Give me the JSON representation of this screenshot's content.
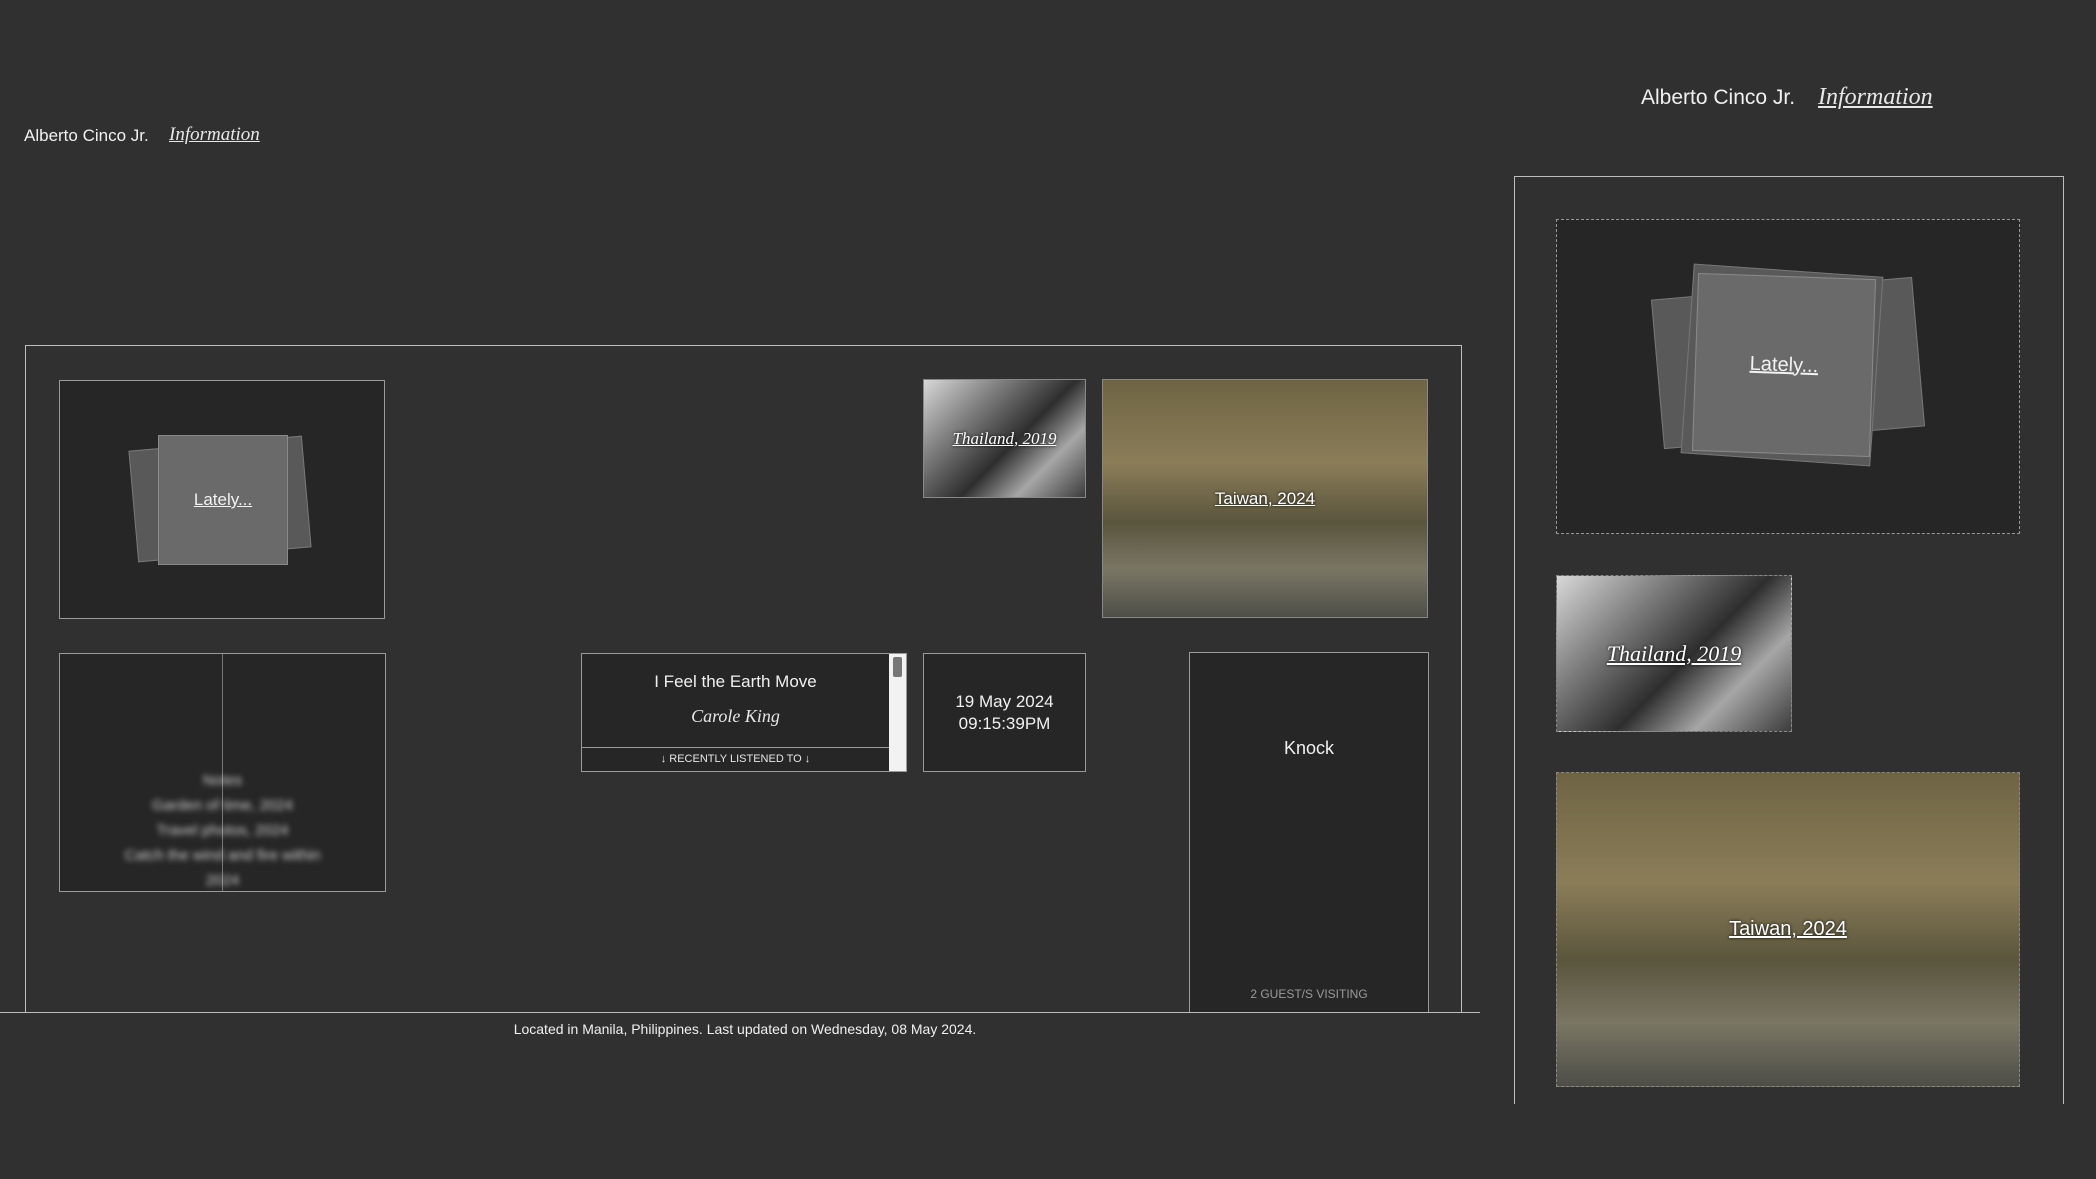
{
  "header": {
    "name": "Alberto Cinco Jr.",
    "info_link": "Information"
  },
  "lately": {
    "label": "Lately..."
  },
  "photos": [
    {
      "label": "Thailand, 2019"
    },
    {
      "label": "Taiwan, 2024"
    }
  ],
  "now_playing": {
    "song": "I Feel the Earth Move",
    "artist": "Carole King",
    "caption": "↓ RECENTLY LISTENED TO ↓"
  },
  "clock": {
    "date": "19 May 2024",
    "time": "09:15:39PM"
  },
  "knock": {
    "label": "Knock",
    "visitors": "2 GUEST/S VISITING"
  },
  "notes": {
    "lines": [
      "Notes",
      "Garden of time, 2024",
      "Travel photos, 2024",
      "Catch the wind and fire within",
      "2024"
    ]
  },
  "footer": {
    "text": "Located in Manila, Philippines. Last updated on Wednesday, 08 May 2024."
  },
  "colors": {
    "background": "#303030",
    "card": "#262626",
    "border": "#9a9a9a"
  }
}
